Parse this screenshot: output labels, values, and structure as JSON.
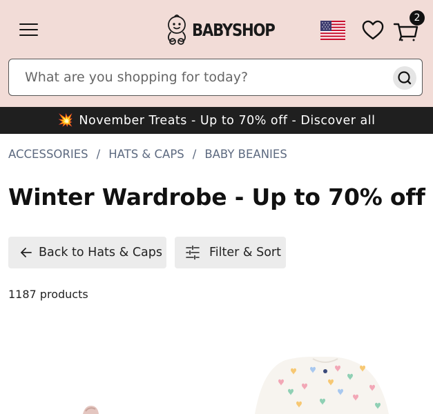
{
  "header": {
    "logo_text": "BABYSHOP",
    "cart_count": "2",
    "flag_icon": "us-flag-icon"
  },
  "search": {
    "placeholder": "What are you shopping for today?"
  },
  "promo": {
    "text": "November Treats - Up to 70% off - Discover all"
  },
  "breadcrumb": [
    "ACCESSORIES",
    "HATS & CAPS",
    "BABY BEANIES"
  ],
  "page": {
    "title": "Winter Wardrobe - Up to 70% off",
    "back_label": "Back to Hats & Caps",
    "filter_label": "Filter & Sort",
    "product_count": "1187 products"
  },
  "colors": {
    "header_bg": "#f2dcd7",
    "promo_bg": "#1f1f1f",
    "breadcrumb": "#5d6a80",
    "pill_bg": "#ececec"
  }
}
